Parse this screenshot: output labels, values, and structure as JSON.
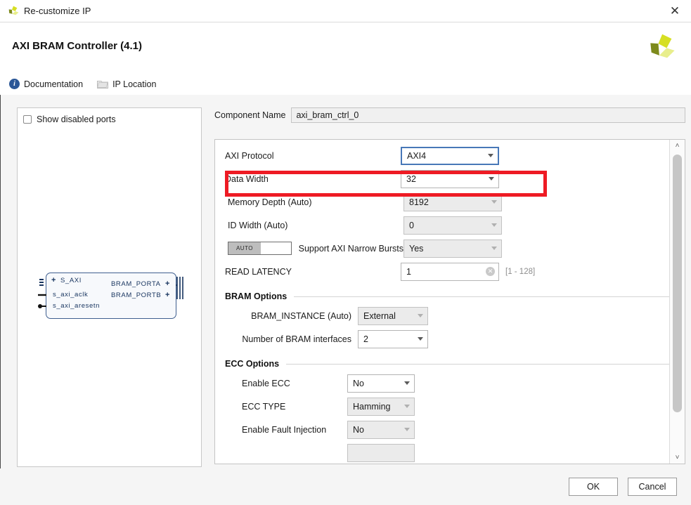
{
  "window": {
    "title": "Re-customize IP",
    "icon": "xilinx-logo-icon",
    "close_label": "✕"
  },
  "header": {
    "ip_title": "AXI BRAM Controller (4.1)",
    "logo": "xilinx-logo-icon"
  },
  "toolbar": {
    "documentation_label": "Documentation",
    "documentation_icon": "info-icon",
    "ip_location_label": "IP Location",
    "ip_location_icon": "folder-icon"
  },
  "diagram": {
    "show_disabled_ports_label": "Show disabled ports",
    "show_disabled_ports_checked": false,
    "block": {
      "left_ports": [
        "S_AXI",
        "s_axi_aclk",
        "s_axi_aresetn"
      ],
      "right_ports": [
        "BRAM_PORTA",
        "BRAM_PORTB"
      ]
    }
  },
  "form": {
    "component_name_label": "Component Name",
    "component_name_value": "axi_bram_ctrl_0",
    "fields": [
      {
        "label": "AXI Protocol",
        "value": "AXI4",
        "state": "focused",
        "type": "select"
      },
      {
        "label": "Data Width",
        "value": "32",
        "state": "enabled",
        "type": "select"
      },
      {
        "label": "Memory Depth (Auto)",
        "value": "8192",
        "state": "disabled",
        "type": "select"
      },
      {
        "label": "ID Width (Auto)",
        "value": "0",
        "state": "disabled",
        "type": "select"
      },
      {
        "label": "Support AXI Narrow Bursts",
        "value": "Yes",
        "state": "disabled",
        "type": "select",
        "toggle": "AUTO"
      },
      {
        "label": "READ LATENCY",
        "value": "1",
        "state": "enabled",
        "type": "text",
        "hint": "[1 - 128]"
      }
    ],
    "sections": [
      {
        "title": "BRAM Options",
        "fields": [
          {
            "label": "BRAM_INSTANCE (Auto)",
            "value": "External",
            "state": "disabled",
            "type": "select"
          },
          {
            "label": "Number of BRAM interfaces",
            "value": "2",
            "state": "enabled",
            "type": "select"
          }
        ]
      },
      {
        "title": "ECC Options",
        "fields": [
          {
            "label": "Enable ECC",
            "value": "No",
            "state": "enabled",
            "type": "select"
          },
          {
            "label": "ECC TYPE",
            "value": "Hamming",
            "state": "disabled",
            "type": "select"
          },
          {
            "label": "Enable Fault Injection",
            "value": "No",
            "state": "disabled",
            "type": "select"
          }
        ]
      }
    ]
  },
  "scrollbar": {
    "up_arrow": "˄",
    "down_arrow": "˅"
  },
  "annotation": {
    "color": "#ee1b24",
    "target": "Data Width"
  },
  "footer": {
    "ok_label": "OK",
    "cancel_label": "Cancel"
  }
}
